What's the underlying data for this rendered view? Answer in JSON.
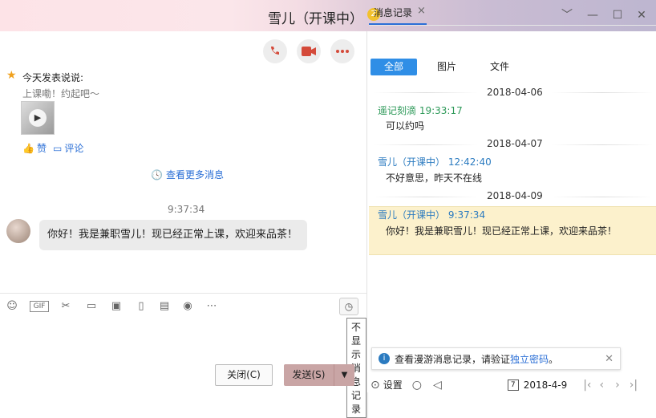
{
  "window": {
    "title": "雪儿（开课中）",
    "badge": "Z",
    "minimize": "﹀",
    "maximize_minus": "—",
    "restore": "☐",
    "close": "✕"
  },
  "feed": {
    "title": "今天发表说说:",
    "subtitle": "上课嘞！约起吧～",
    "like": "赞",
    "comment": "评论"
  },
  "chat": {
    "more": "查看更多消息",
    "timestamp": "9:37:34",
    "message": "你好！我是兼职雪儿！现已经正常上课，欢迎来品茶！"
  },
  "toolbar": {
    "tooltip": "不显示消息记录"
  },
  "buttons": {
    "close": "关闭(C)",
    "send": "发送(S)"
  },
  "history": {
    "tab": "消息记录",
    "filters": [
      "全部",
      "图片",
      "文件"
    ],
    "groups": [
      {
        "date": "2018-04-06",
        "sender": "遥记刻滴 19:33:17",
        "text": "可以约吗"
      },
      {
        "date": "2018-04-07",
        "sender": "雪儿（开课中） 12:42:40",
        "text": "不好意思，昨天不在线"
      },
      {
        "date": "2018-04-09",
        "sender": "雪儿（开课中） 9:37:34",
        "text": "你好！我是兼职雪儿！现已经正常上课，欢迎来品茶！"
      }
    ],
    "notice_prefix": "查看漫游消息记录，请验证",
    "notice_link": "独立密码",
    "notice_suffix": "。",
    "settings": "设置",
    "date_value": "2018-4-9",
    "calendar_day": "7"
  }
}
